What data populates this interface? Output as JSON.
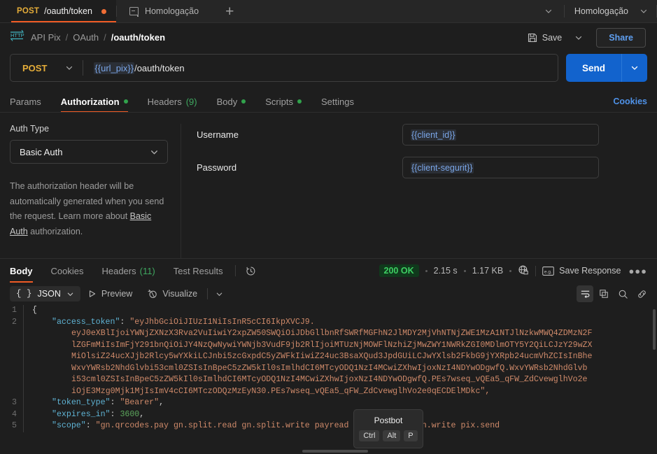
{
  "tabstrip": {
    "request_tab": {
      "method": "POST",
      "title": "/oauth/token",
      "unsaved": "●"
    },
    "env_tab": {
      "label": "Homologação"
    },
    "new_tab": "+",
    "environment_selector": {
      "value": "Homologação"
    }
  },
  "breadcrumb": {
    "icon": "http-icon",
    "items": [
      "API Pix",
      "OAuth"
    ],
    "separator": "/",
    "current": "/oauth/token",
    "save_label": "Save",
    "share_label": "Share"
  },
  "url_bar": {
    "method": "POST",
    "variable": "{{url_pix}}",
    "path": "/oauth/token",
    "send_label": "Send"
  },
  "request_tabs": {
    "items": [
      {
        "label": "Params",
        "active": false,
        "dot": false,
        "count": ""
      },
      {
        "label": "Authorization",
        "active": true,
        "dot": true,
        "count": ""
      },
      {
        "label": "Headers",
        "active": false,
        "dot": false,
        "count": "(9)"
      },
      {
        "label": "Body",
        "active": false,
        "dot": true,
        "count": ""
      },
      {
        "label": "Scripts",
        "active": false,
        "dot": true,
        "count": ""
      },
      {
        "label": "Settings",
        "active": false,
        "dot": false,
        "count": ""
      }
    ],
    "cookies_link": "Cookies"
  },
  "auth": {
    "type_label": "Auth Type",
    "type_value": "Basic Auth",
    "help_before": "The authorization header will be automatically generated when you send the request. Learn more about ",
    "help_link": "Basic Auth",
    "help_after": " authorization.",
    "fields": [
      {
        "name": "Username",
        "value": "{{client_id}}"
      },
      {
        "name": "Password",
        "value": "{{client-segurit}}"
      }
    ]
  },
  "response": {
    "tabs": [
      {
        "label": "Body",
        "active": true,
        "count": ""
      },
      {
        "label": "Cookies",
        "active": false,
        "count": ""
      },
      {
        "label": "Headers",
        "active": false,
        "count": "(11)"
      },
      {
        "label": "Test Results",
        "active": false,
        "count": ""
      }
    ],
    "status": "200 OK",
    "time": "2.15 s",
    "size": "1.17 KB",
    "save_response_label": "Save Response",
    "more_label": "●●●",
    "format": "JSON",
    "preview_label": "Preview",
    "visualize_label": "Visualize"
  },
  "body": {
    "lines": [
      {
        "no": "1",
        "html_key": "",
        "text": "{"
      },
      {
        "no": "2",
        "key": "\"access_token\"",
        "value": "\"eyJhbGciOiJIUzI1NiIsInR5cCI6IkpXVCJ9.eyJ0eXBlIjoiYWNjZXNzX3Rva2VuIiwiY2xpZW50SWQiOiJDbGllbnRfSWRfMGFhN2JlMDY2MjVhNTNjZWE1MzA1NTJlNzkwMWQ4ZDMzN2FlZGFmMiIsImFjY291bnQiOiJY4NzQwNywiYWNjb3VudF9jb2RlIjoiMTUzNjNiZDQ4NTEzMzJlOWFlNzhiZjJmMwZWY1NWRkZGI0MDlmOTY5Y2QiLCJzY29wZXMiOiZ24ucXJjb2Rlcy5wYXkiLCJnbi5zcGxpdC5yZWFkIiwiZ24uc3BsaXQud3JpdGUiLCJwYXlsb2FkbG9jYXRpb24ucmVhZCIsInBheWxvYWRsb2NhdGlvbi53cml0ZSIsInBpeC5zZW5kIl0sImlhdCI6MTcyODQ1NzI4MCwiZXhwIjoxNzI4NDYwODgwfQ.WxvYWRsb2NhdGlvbi5yZWFkIiwicGF5bG9hZGxvY2F0aW9uLndyaXRlIiwicGl4LnNlbmQiXSwiaWF0IjoxNzI4NDU3MjgwLCJleHAiOjE3Mjg0NjA4ODB9.PEs7wseq_vQEa5_qFW_ZdCvewglhVo2e0qECDElMDkc\"",
        "comma": ","
      },
      {
        "no": "3",
        "key": "\"token_type\"",
        "value": "\"Bearer\"",
        "comma": ","
      },
      {
        "no": "4",
        "key": "\"expires_in\"",
        "value": "3600",
        "numeric": true,
        "comma": ","
      },
      {
        "no": "5",
        "key": "\"scope\"",
        "value": "\"gn.qrcodes.pay gn.split.read gn.split.write payloadlocation.read payloadlocation.write pix.send",
        "comma": ""
      }
    ],
    "line1": "{",
    "token_key": "\"access_token\"",
    "token_segments": [
      "\"eyJhbGciOiJIUzI1NiIsInR5cCI6IkpXVCJ9.",
      "eyJ0eXBlIjoiYWNjZXNzX3Rva2VuIiwiY2xpZW50SWQiOiJDbGllbnRfSWRfMGFhN2JlMDY2MjVhNTNjZWE1MzA1NTJlNzkwMWQ4ZDMzN2F",
      "lZGFmMiIsImFjY291bnQiOiJY4NzQwNywiYWNjb3VudF9jb2RlIjoiMTUzNjMOWFlNzhiZjMwZWY1NWRkZGI0MDlmOTY5Y2QiLCJzY29wZX",
      "MiOlsiZ24ucXJjb2Rlcy5wYXkiLCJnbi5zcGxpdC5yZWFkIiwiZ24uc3BsaXQud3JpdGUiLCJwYXlsb2FkbG9jYXRpb24ucmVhZCIsInBhe",
      "WxvYWRsb2NhdGlvbi53cml0ZSIsInBpeC5zZW5kIl0sImlhdCI6MTcyODQ1NzI4MCwiZXhwIjoxNzI4NDYwODgwfQ.WxvYWRsb2NhdGlvb",
      "i53cml0ZSIsInBpeC5zZW5kIl0sImlhdCI6MTcyODQ1NzI4MCwiZXhwIjoxNzI4NDYwODgwfQ.PEs7wseq_vQEa5_qFW_ZdCvewglhVo2e",
      "iOjE3Mzg0Mjk1MjIsImV4cCI6MTczODQzMzEyN30.PEs7wseq_vQEa5_qFW_ZdCvewglhVo2e0qECDElMDkc\","
    ],
    "token_type_key": "\"token_type\"",
    "token_type_value": "\"Bearer\"",
    "expires_key": "\"expires_in\"",
    "expires_value": "3600",
    "scope_key": "\"scope\"",
    "scope_value": "\"gn.qrcodes.pay gn.split.read gn.split.write pay",
    "scope_value_tail": "read payloadlocation.write pix.send",
    "colon": ":",
    "comma": ","
  },
  "postbot": {
    "title": "Postbot",
    "keys": [
      "Ctrl",
      "Alt",
      "P"
    ]
  },
  "colors": {
    "accent_orange": "#ef5b25",
    "send_blue": "#1263cd",
    "status_green": "#3ecf63",
    "method_yellow": "#e5ad39",
    "variable_blue": "#7aa6e8",
    "json_key": "#5fb3d4",
    "json_string": "#cf8a6a",
    "json_number": "#5ca75c"
  }
}
